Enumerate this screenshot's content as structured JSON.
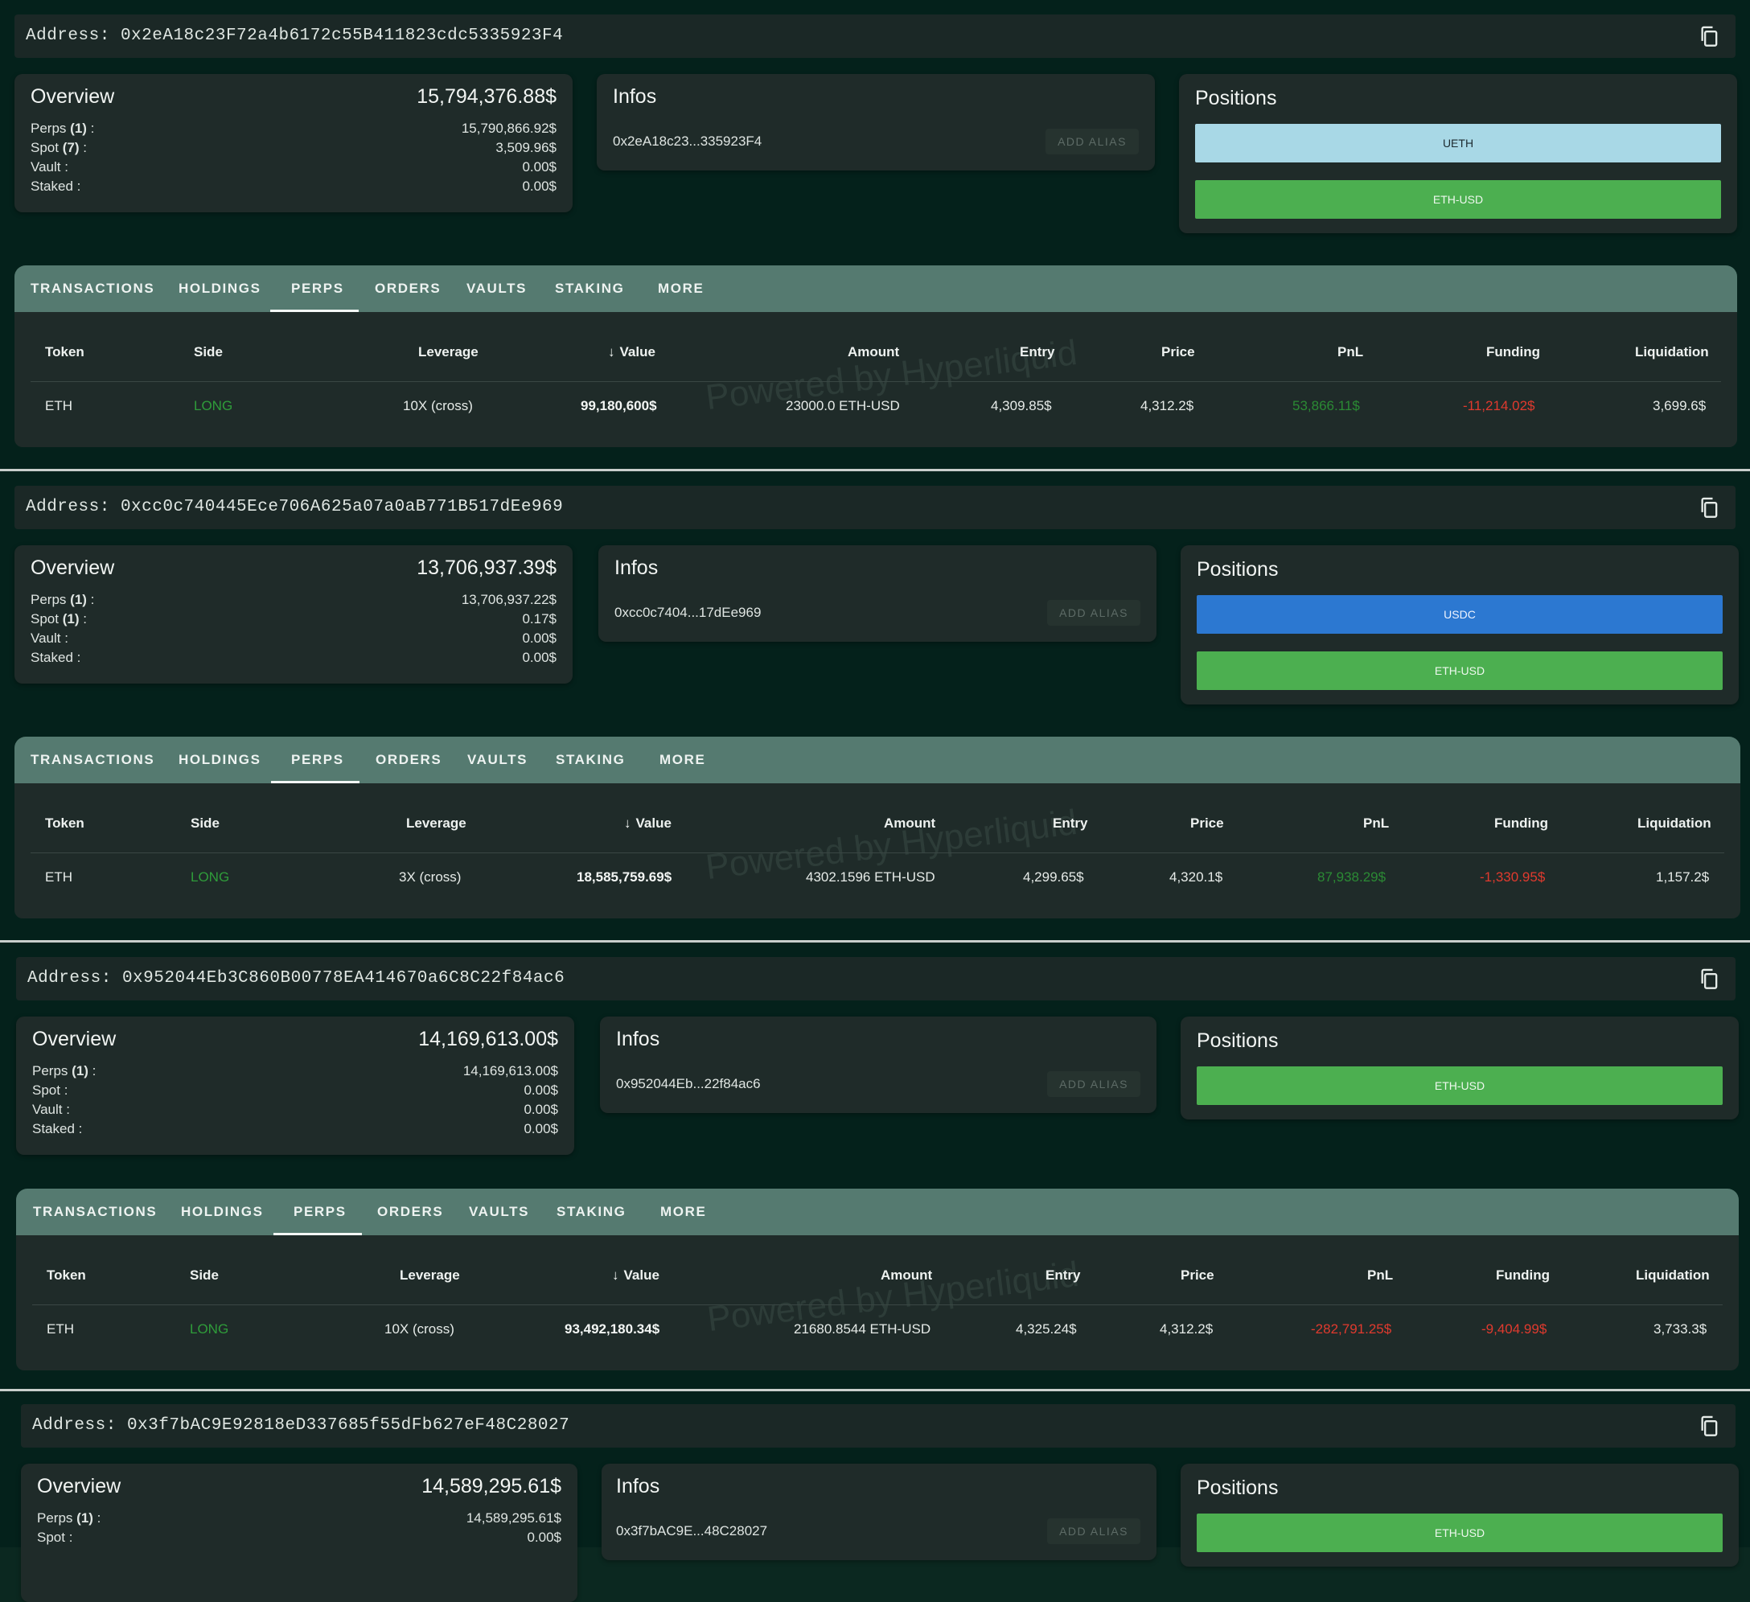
{
  "address_prefix": "Address:",
  "tabs": [
    "TRANSACTIONS",
    "HOLDINGS",
    "PERPS",
    "ORDERS",
    "VAULTS",
    "STAKING",
    "MORE"
  ],
  "active_tab": "PERPS",
  "card_titles": {
    "overview": "Overview",
    "infos": "Infos",
    "positions": "Positions"
  },
  "add_alias_label": "ADD ALIAS",
  "overview_labels": {
    "perps": "Perps",
    "spot": "Spot",
    "vault": "Vault :",
    "staked": "Staked :"
  },
  "table_headers": {
    "token": "Token",
    "side": "Side",
    "leverage": "Leverage",
    "value": "Value",
    "amount": "Amount",
    "entry": "Entry",
    "price": "Price",
    "pnl": "PnL",
    "funding": "Funding",
    "liquidation": "Liquidation"
  },
  "watermark": "Powered by Hyperliquid",
  "colors": {
    "long": "#2f9c3a",
    "negative": "#e03a2e",
    "ueth": "#a8d8e6",
    "usdc": "#2c78d1",
    "eth_usd": "#4caf50",
    "tab_bar": "#557a70"
  },
  "wallets": [
    {
      "address": "0x2eA18c23F72a4b6172c55B411823cdc5335923F4",
      "short_address": "0x2eA18c23...335923F4",
      "overview": {
        "total": "15,794,376.88$",
        "perps_count": "(1)",
        "perps": "15,790,866.92$",
        "spot_count": "(7)",
        "spot": "3,509.96$",
        "vault": "0.00$",
        "staked": "0.00$"
      },
      "positions": [
        "UETH",
        "ETH-USD"
      ],
      "row": {
        "token": "ETH",
        "side": "LONG",
        "leverage": "10X (cross)",
        "value": "99,180,600$",
        "amount": "23000.0 ETH-USD",
        "entry": "4,309.85$",
        "price": "4,312.2$",
        "pnl": "53,866.11$",
        "funding": "-11,214.02$",
        "liquidation": "3,699.6$"
      }
    },
    {
      "address": "0xcc0c740445Ece706A625a07a0aB771B517dEe969",
      "short_address": "0xcc0c7404...17dEe969",
      "overview": {
        "total": "13,706,937.39$",
        "perps_count": "(1)",
        "perps": "13,706,937.22$",
        "spot_count": "(1)",
        "spot": "0.17$",
        "vault": "0.00$",
        "staked": "0.00$"
      },
      "positions": [
        "USDC",
        "ETH-USD"
      ],
      "row": {
        "token": "ETH",
        "side": "LONG",
        "leverage": "3X (cross)",
        "value": "18,585,759.69$",
        "amount": "4302.1596 ETH-USD",
        "entry": "4,299.65$",
        "price": "4,320.1$",
        "pnl": "87,938.29$",
        "funding": "-1,330.95$",
        "liquidation": "1,157.2$"
      }
    },
    {
      "address": "0x952044Eb3C860B00778EA414670a6C8C22f84ac6",
      "short_address": "0x952044Eb...22f84ac6",
      "overview": {
        "total": "14,169,613.00$",
        "perps_count": "(1)",
        "perps": "14,169,613.00$",
        "spot_count": "",
        "spot": "0.00$",
        "vault": "0.00$",
        "staked": "0.00$"
      },
      "positions": [
        "ETH-USD"
      ],
      "row": {
        "token": "ETH",
        "side": "LONG",
        "leverage": "10X (cross)",
        "value": "93,492,180.34$",
        "amount": "21680.8544 ETH-USD",
        "entry": "4,325.24$",
        "price": "4,312.2$",
        "pnl": "-282,791.25$",
        "funding": "-9,404.99$",
        "liquidation": "3,733.3$"
      }
    },
    {
      "address": "0x3f7bAC9E92818eD337685f55dFb627eF48C28027",
      "short_address": "0x3f7bAC9E...48C28027",
      "overview": {
        "total": "14,589,295.61$",
        "perps_count": "(1)",
        "perps": "14,589,295.61$",
        "spot_count": "",
        "spot": "0.00$"
      },
      "positions": [
        "ETH-USD"
      ]
    }
  ]
}
